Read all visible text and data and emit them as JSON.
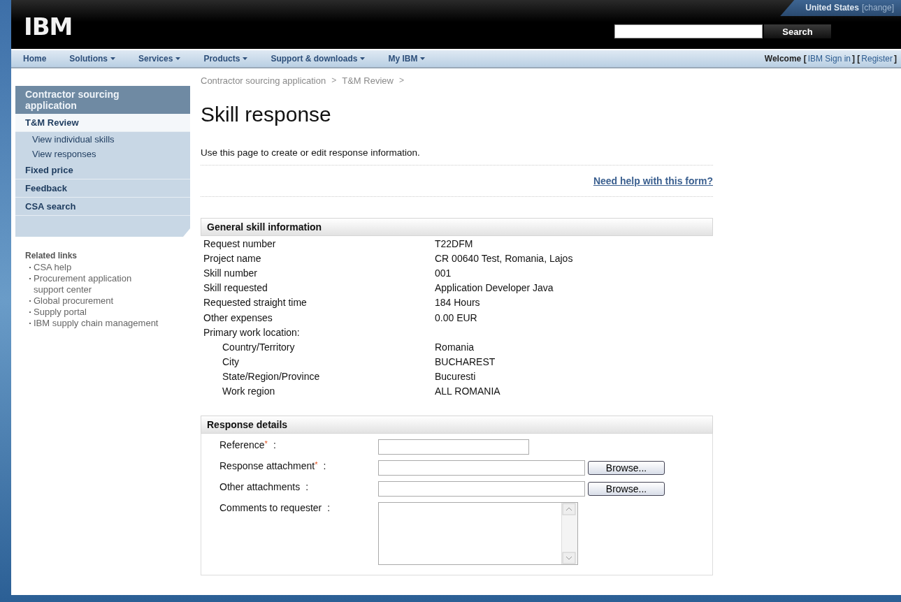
{
  "masthead": {
    "logo": "IBM",
    "country": "United States",
    "country_link": "[change]",
    "search_button": "Search"
  },
  "nav": {
    "items": [
      {
        "label": "Home",
        "has_menu": false
      },
      {
        "label": "Solutions",
        "has_menu": true
      },
      {
        "label": "Services",
        "has_menu": true
      },
      {
        "label": "Products",
        "has_menu": true
      },
      {
        "label": "Support & downloads",
        "has_menu": true
      },
      {
        "label": "My IBM",
        "has_menu": true
      }
    ],
    "welcome": [
      {
        "kind": "text",
        "text": "Welcome ["
      },
      {
        "kind": "link",
        "text": "IBM Sign in"
      },
      {
        "kind": "text",
        "text": "] ["
      },
      {
        "kind": "link",
        "text": "Register"
      },
      {
        "kind": "text",
        "text": "]"
      }
    ]
  },
  "sidebar": {
    "title": "Contractor sourcing application",
    "items": [
      {
        "label": "T&M Review",
        "selected": true,
        "children": [
          {
            "label": "View individual skills",
            "selected": false
          },
          {
            "label": "View responses",
            "selected": false
          }
        ]
      },
      {
        "label": "Fixed price",
        "selected": false
      },
      {
        "label": "Feedback",
        "selected": false
      },
      {
        "label": "CSA search",
        "selected": false
      }
    ],
    "related_title": "Related links",
    "related_links": [
      "CSA help",
      "Procurement application support center",
      "Global procurement",
      "Supply portal",
      "IBM supply chain management"
    ]
  },
  "breadcrumb": [
    {
      "kind": "link",
      "text": "Contractor sourcing application"
    },
    {
      "kind": "sep",
      "text": ">"
    },
    {
      "kind": "link",
      "text": "T&M Review"
    },
    {
      "kind": "sep",
      "text": ">"
    }
  ],
  "title": "Skill response",
  "intro": "Use this page to create or edit response information.",
  "help_link": "Need help with this form?",
  "general": {
    "title": "General skill information",
    "rows": [
      {
        "label": "Request number",
        "value": "T22DFM"
      },
      {
        "label": "Project name",
        "value": "CR 00640 Test, Romania, Lajos"
      },
      {
        "label": "Skill number",
        "value": "001"
      },
      {
        "label": "Skill requested",
        "value": "Application Developer Java"
      },
      {
        "label": "Requested straight time",
        "value": "184 Hours"
      },
      {
        "label": "Other expenses",
        "value": "0.00 EUR"
      },
      {
        "label": "Primary work location:",
        "children": [
          {
            "label": "Country/Territory",
            "value": "Romania"
          },
          {
            "label": "City",
            "value": "BUCHAREST"
          },
          {
            "label": "State/Region/Province",
            "value": "Bucuresti"
          },
          {
            "label": "Work region",
            "value": "ALL ROMANIA"
          }
        ]
      }
    ]
  },
  "response": {
    "title": "Response details",
    "required_mark": "*",
    "fields": [
      {
        "kind": "text",
        "label": "Reference",
        "required": true,
        "separator": ":"
      },
      {
        "kind": "file",
        "label": "Response attachment",
        "required": true,
        "separator": ":",
        "button": "Browse..."
      },
      {
        "kind": "file",
        "label": "Other attachments",
        "required": false,
        "separator": ":",
        "button": "Browse..."
      },
      {
        "kind": "textarea",
        "label": "Comments to requester",
        "required": false,
        "separator": ":"
      }
    ]
  }
}
